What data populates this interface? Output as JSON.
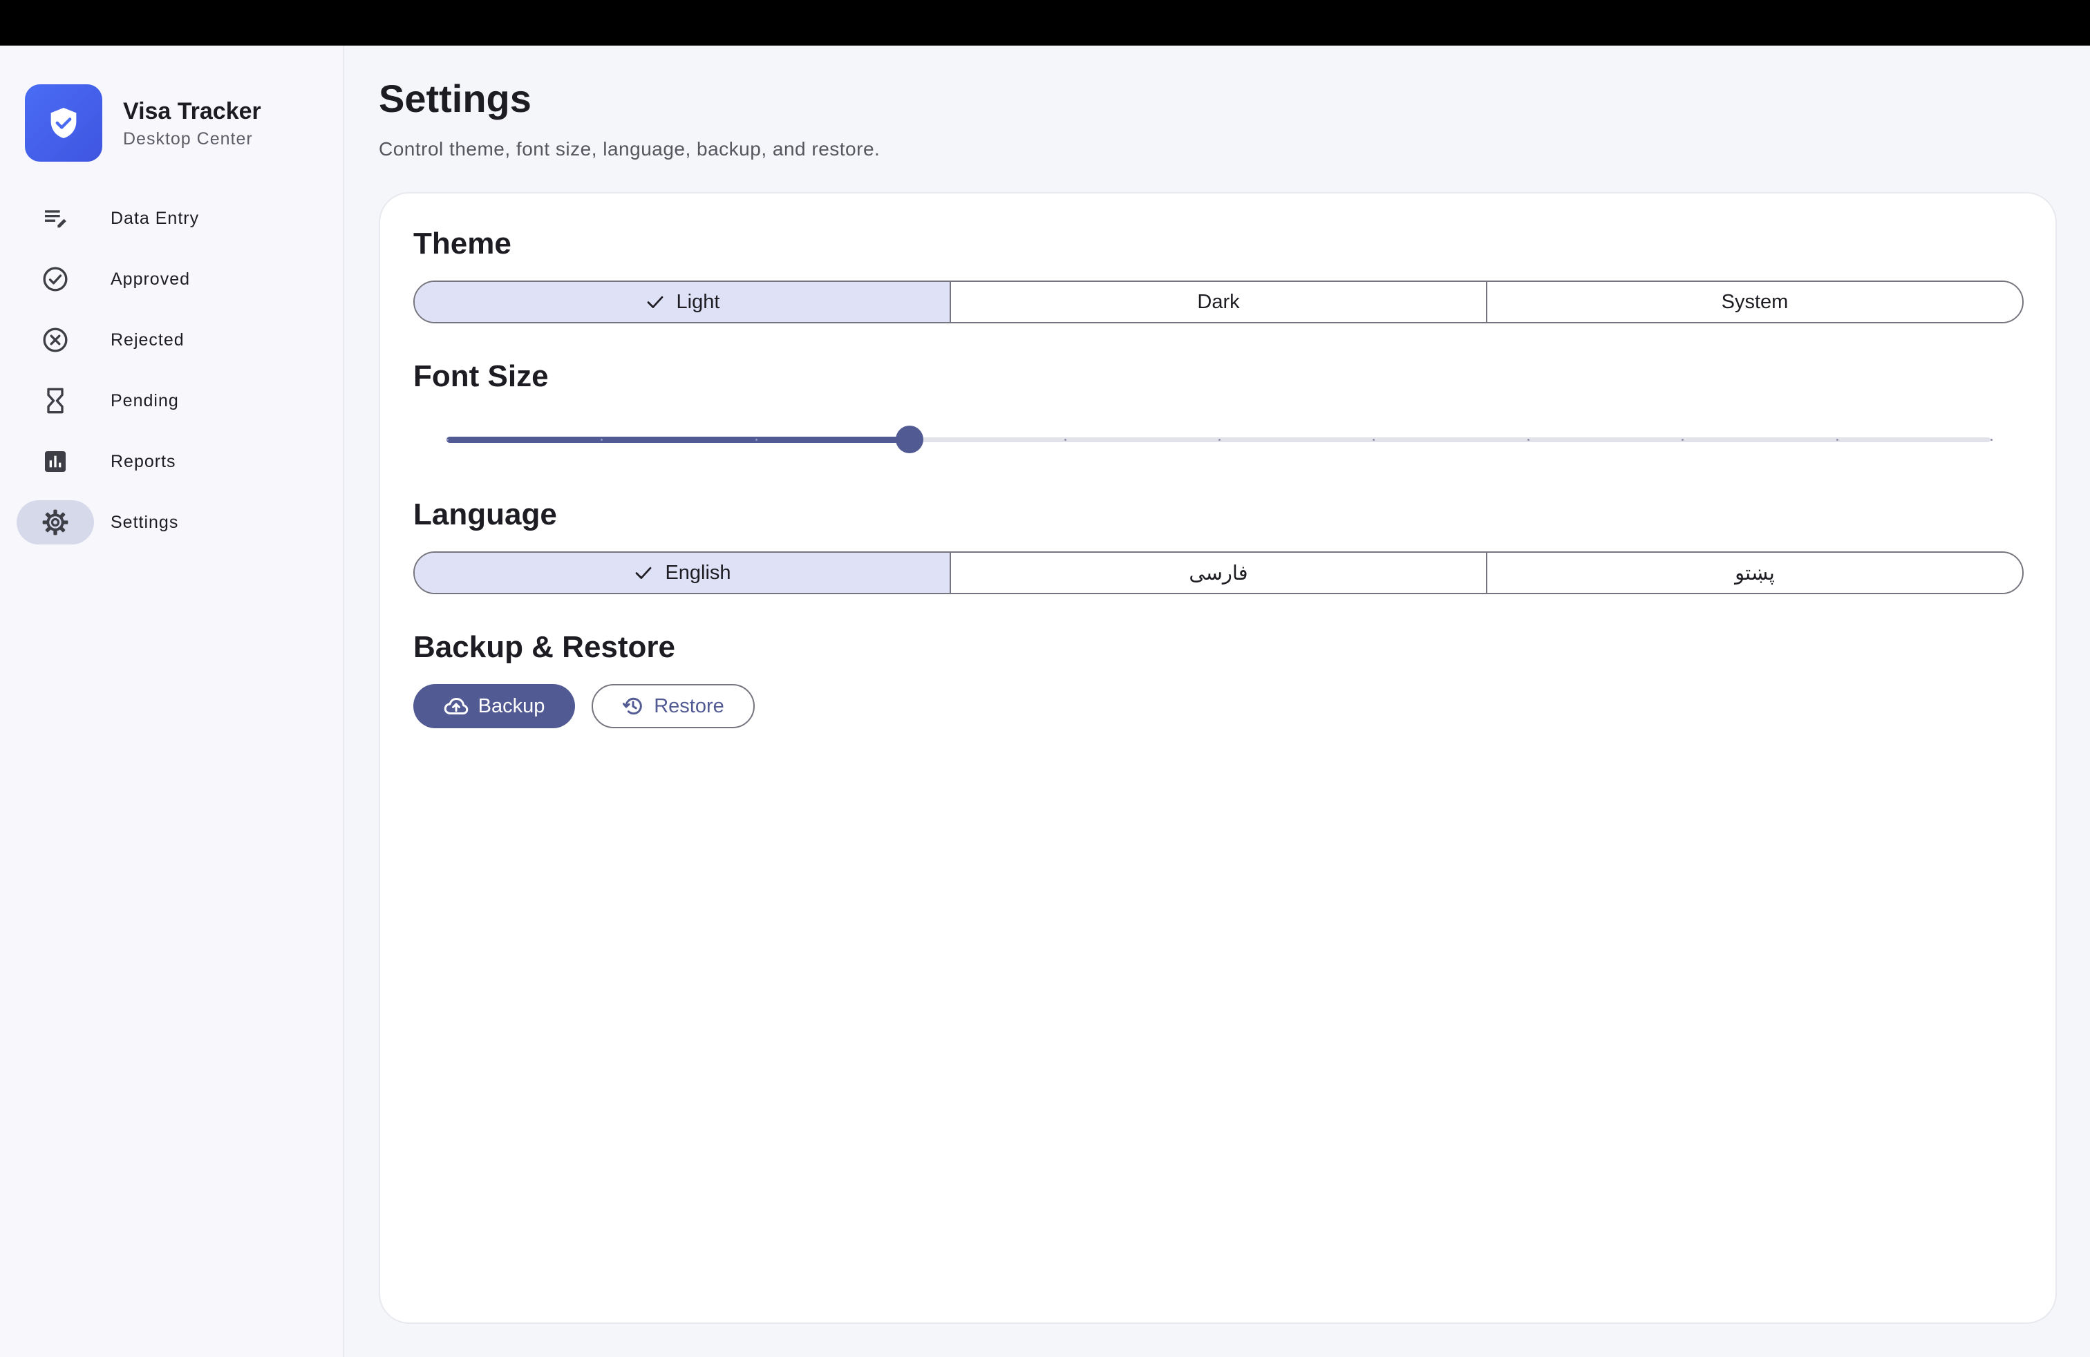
{
  "app": {
    "title": "Visa Tracker",
    "subtitle": "Desktop Center",
    "logo_icon": "shield-check-icon",
    "brand_color": "#4a6cf4"
  },
  "sidebar": {
    "items": [
      {
        "label": "Data Entry",
        "icon": "edit-list-icon",
        "active": false
      },
      {
        "label": "Approved",
        "icon": "check-circle-icon",
        "active": false
      },
      {
        "label": "Rejected",
        "icon": "x-circle-icon",
        "active": false
      },
      {
        "label": "Pending",
        "icon": "hourglass-icon",
        "active": false
      },
      {
        "label": "Reports",
        "icon": "bar-chart-icon",
        "active": false
      },
      {
        "label": "Settings",
        "icon": "gear-icon",
        "active": true
      }
    ]
  },
  "page": {
    "title": "Settings",
    "subtitle": "Control theme, font size, language, backup, and restore."
  },
  "theme": {
    "title": "Theme",
    "options": [
      "Light",
      "Dark",
      "System"
    ],
    "selected": "Light"
  },
  "font_size": {
    "title": "Font Size",
    "steps": 10,
    "value_step": 3,
    "accent_color": "#525a93"
  },
  "language": {
    "title": "Language",
    "options": [
      "English",
      "فارسی",
      "پښتو"
    ],
    "selected": "English"
  },
  "backup": {
    "title": "Backup & Restore",
    "backup_label": "Backup",
    "backup_icon": "cloud-upload-icon",
    "restore_label": "Restore",
    "restore_icon": "history-icon"
  }
}
